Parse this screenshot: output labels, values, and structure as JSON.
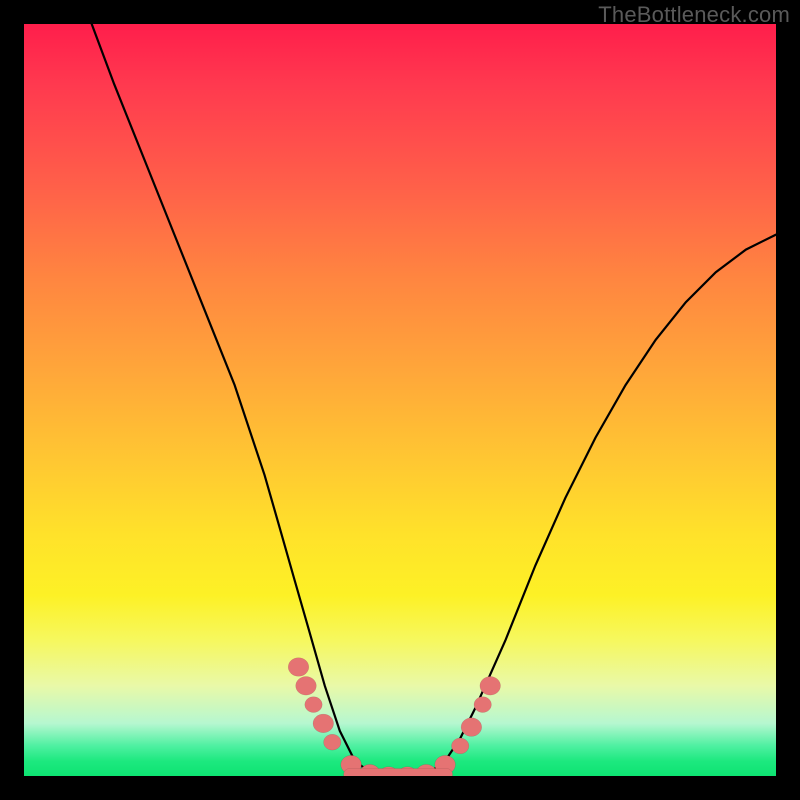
{
  "watermark": "TheBottleneck.com",
  "chart_data": {
    "type": "line",
    "title": "",
    "xlabel": "",
    "ylabel": "",
    "xlim": [
      0,
      100
    ],
    "ylim": [
      0,
      100
    ],
    "series": [
      {
        "name": "curve",
        "x": [
          9,
          12,
          16,
          20,
          24,
          28,
          32,
          34,
          36,
          38,
          40,
          42,
          44,
          46,
          48,
          50,
          52,
          54,
          56,
          58,
          60,
          64,
          68,
          72,
          76,
          80,
          84,
          88,
          92,
          96,
          100
        ],
        "y": [
          100,
          92,
          82,
          72,
          62,
          52,
          40,
          33,
          26,
          19,
          12,
          6,
          2,
          0.5,
          0,
          0,
          0,
          0.5,
          2,
          5,
          9,
          18,
          28,
          37,
          45,
          52,
          58,
          63,
          67,
          70,
          72
        ]
      }
    ],
    "markers": [
      {
        "x": 36.5,
        "y": 14.5,
        "r": 1.3
      },
      {
        "x": 37.5,
        "y": 12.0,
        "r": 1.3
      },
      {
        "x": 38.5,
        "y": 9.5,
        "r": 1.1
      },
      {
        "x": 39.8,
        "y": 7.0,
        "r": 1.3
      },
      {
        "x": 41.0,
        "y": 4.5,
        "r": 1.1
      },
      {
        "x": 43.5,
        "y": 1.5,
        "r": 1.3
      },
      {
        "x": 46.0,
        "y": 0.3,
        "r": 1.3
      },
      {
        "x": 48.5,
        "y": 0.0,
        "r": 1.3
      },
      {
        "x": 51.0,
        "y": 0.0,
        "r": 1.3
      },
      {
        "x": 53.5,
        "y": 0.3,
        "r": 1.3
      },
      {
        "x": 56.0,
        "y": 1.5,
        "r": 1.3
      },
      {
        "x": 58.0,
        "y": 4.0,
        "r": 1.1
      },
      {
        "x": 59.5,
        "y": 6.5,
        "r": 1.3
      },
      {
        "x": 61.0,
        "y": 9.5,
        "r": 1.1
      },
      {
        "x": 62.0,
        "y": 12.0,
        "r": 1.3
      }
    ],
    "bottom_bar": {
      "x0": 42.5,
      "x1": 57.0,
      "y": 0.2,
      "thickness": 1.6
    }
  }
}
